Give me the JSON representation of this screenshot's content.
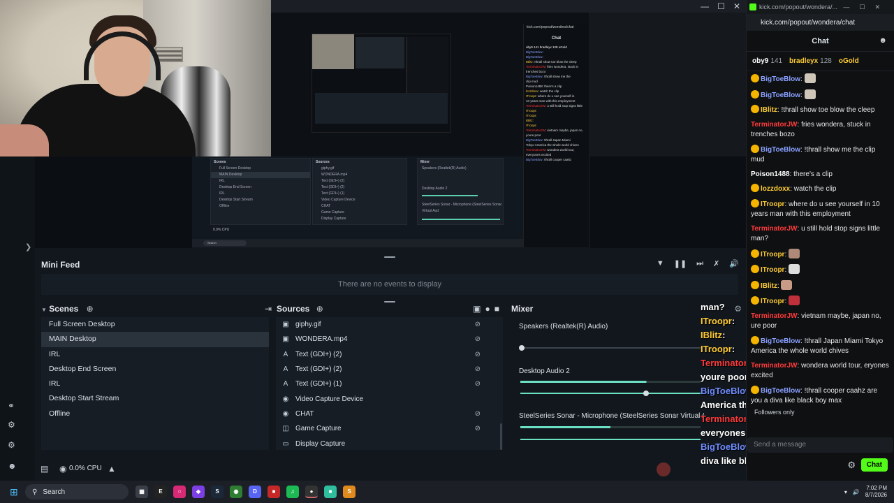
{
  "obs": {
    "minifeed": {
      "title": "Mini Feed",
      "empty_text": "There are no events to display"
    },
    "scenes": {
      "title": "Scenes",
      "items": [
        "Full Screen Desktop",
        "MAIN Desktop",
        "IRL",
        "Desktop End Screen",
        "IRL",
        "Desktop Start Stream",
        "Offline"
      ],
      "selected_index": 1
    },
    "sources": {
      "title": "Sources",
      "items": [
        {
          "icon": "image-icon",
          "label": "giphy.gif"
        },
        {
          "icon": "media-icon",
          "label": "WONDERA.mp4"
        },
        {
          "icon": "text-icon",
          "label": "Text (GDI+) (2)"
        },
        {
          "icon": "text-icon",
          "label": "Text (GDI+) (2)"
        },
        {
          "icon": "text-icon",
          "label": "Text (GDI+) (1)"
        },
        {
          "icon": "camera-icon",
          "label": "Video Capture Device"
        },
        {
          "icon": "browser-icon",
          "label": "CHAT"
        },
        {
          "icon": "gamepad-icon",
          "label": "Game Capture"
        },
        {
          "icon": "monitor-icon",
          "label": "Display Capture"
        }
      ]
    },
    "mixer": {
      "title": "Mixer",
      "channels": [
        {
          "name": "Speakers (Realtek(R) Audio)",
          "level": 0.0
        },
        {
          "name": "Desktop Audio 2",
          "level": 0.7
        },
        {
          "name": "SteelSeries Sonar - Microphone (SteelSeries Sonar Virtual Aud",
          "level": 0.5
        }
      ]
    },
    "status": {
      "cpu": "0.0% CPU"
    }
  },
  "overlay": {
    "header": "man?",
    "lines": [
      {
        "user": "ITroopr",
        "color": "#ffcc33",
        "text": ""
      },
      {
        "user": "IBlitz",
        "color": "#ffcc33",
        "text": ""
      },
      {
        "user": "ITroopr",
        "color": "#ffcc33",
        "text": ""
      },
      {
        "user": "TerminatorJW",
        "color": "#ff3b3b",
        "text": "vietnam maybe, japan no, youre poor"
      },
      {
        "user": "BigToeBlow",
        "color": "#6f8cff",
        "text": "!thrall Japan Miami Tokyo America the whole world chives"
      },
      {
        "user": "TerminatorJW",
        "color": "#ff3b3b",
        "text": "wondera world tour, everyones excited"
      },
      {
        "user": "BigToeBlow",
        "color": "#6f8cff",
        "text": "!thrall cooper caahz are you a diva like black boy max"
      }
    ]
  },
  "kick": {
    "tab_title": "kick.com/popout/wondera/...",
    "url": "kick.com/popout/wondera/chat",
    "header": "Chat",
    "leaders": [
      {
        "name": "oby9",
        "count": "141",
        "color": "#ffffff"
      },
      {
        "name": "bradleyx",
        "count": "128",
        "color": "#ffcc33"
      },
      {
        "name": "oGold",
        "count": "",
        "color": "#ffcc33"
      }
    ],
    "messages": [
      {
        "user": "BigToeBlow",
        "color": "#8aa0ff",
        "text": "",
        "emote": "#cfc6ba"
      },
      {
        "user": "BigToeBlow",
        "color": "#8aa0ff",
        "text": "",
        "emote": "#cfc6ba"
      },
      {
        "user": "IBlitz",
        "color": "#ffcc33",
        "text": "!thrall show toe blow the cleep"
      },
      {
        "user": "TerminatorJW",
        "color": "#ff3b3b",
        "text": "fries wondera, stuck in trenches bozo"
      },
      {
        "user": "BigToeBlow",
        "color": "#8aa0ff",
        "text": "!thrall show me the clip mud"
      },
      {
        "user": "Poison1488",
        "color": "#ffffff",
        "text": "there's a clip"
      },
      {
        "user": "lozzdoxx",
        "color": "#ffcc33",
        "text": "watch the clip"
      },
      {
        "user": "ITroopr",
        "color": "#ffcc33",
        "text": "where do u see yourself in 10 years man with this employment"
      },
      {
        "user": "TerminatorJW",
        "color": "#ff3b3b",
        "text": "u still hold stop signs little man?"
      },
      {
        "user": "ITroopr",
        "color": "#ffcc33",
        "text": "",
        "emote": "#b08a78"
      },
      {
        "user": "ITroopr",
        "color": "#ffcc33",
        "text": "",
        "emote": "#dddddd"
      },
      {
        "user": "IBlitz",
        "color": "#ffcc33",
        "text": "",
        "emote": "#c99a86"
      },
      {
        "user": "ITroopr",
        "color": "#ffcc33",
        "text": "",
        "emote": "#c0303a"
      },
      {
        "user": "TerminatorJW",
        "color": "#ff3b3b",
        "text": "vietnam maybe, japan no, ure poor"
      },
      {
        "user": "BigToeBlow",
        "color": "#8aa0ff",
        "text": "!thrall Japan Miami Tokyo America the whole world chives"
      },
      {
        "user": "TerminatorJW",
        "color": "#ff3b3b",
        "text": "wondera world tour, eryones excited"
      },
      {
        "user": "BigToeBlow",
        "color": "#8aa0ff",
        "text": "!thrall cooper caahz are you a diva like black boy max"
      }
    ],
    "followers_only": "Followers only",
    "input_placeholder": "Send a message",
    "send_label": "Chat"
  },
  "taskbar": {
    "search_label": "Search",
    "time": "7:02 PM",
    "date": "8/7/2026"
  }
}
